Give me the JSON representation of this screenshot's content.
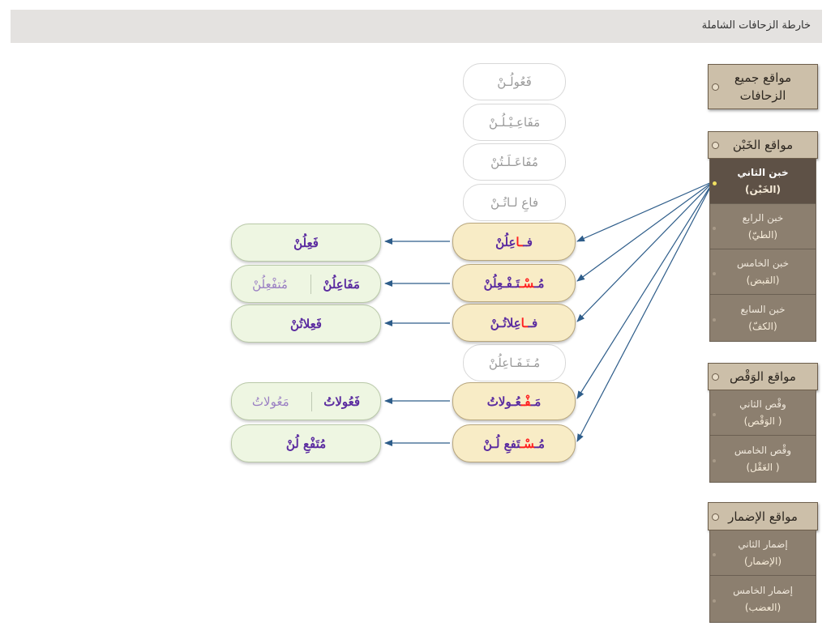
{
  "page_title": "خارطة الزحافات الشاملة",
  "ghost_feet": {
    "f1": "فَعُولُـنْ",
    "f2": "مَفَاعِـيْـلُـنْ",
    "f3": "مُفَاعَـلَـتُنْ",
    "f4": "فاعِ لـاتُـنْ",
    "f5": "مُـتَـفَـاعِلُنْ"
  },
  "active_feet": {
    "a1": {
      "p1": "فـ",
      "red": "ـا",
      "p2": "عِلُنْ"
    },
    "a2": {
      "p1": "مُـ",
      "red": "سْـ",
      "p2": "تَـفْـعِلُنْ"
    },
    "a3": {
      "p1": "فـ",
      "red": "ـا",
      "p2": "عِلاتُـنْ"
    },
    "a4": {
      "p1": "مَـ",
      "red": "فْـ",
      "p2": "عُـولاتُ"
    },
    "a5": {
      "p1": "مُـ",
      "red": "سْـ",
      "p2": "تَفعِ لُـنْ"
    }
  },
  "results": {
    "r1": "فَعِلُنْ",
    "r2_main": "مَفَاعِلُنْ",
    "r2_alt": "مُتفْعِلُنْ",
    "r3": "فَعِلاتُنْ",
    "r4_main": "فَعُولاتُ",
    "r4_alt": "مَعُولاتُ",
    "r5": "مُتَفْعِ لُنْ"
  },
  "panel": {
    "all": "مواقع جميع الزحافات",
    "khabn": {
      "header": "مواقع الخَبْن",
      "items": [
        {
          "label": "خبن الثاني",
          "sub": "(الخَبْن)"
        },
        {
          "label": "خبن الرابع",
          "sub": "(الطيّ)"
        },
        {
          "label": "خبن الخامس",
          "sub": "(القبض)"
        },
        {
          "label": "خبن السابع",
          "sub": "(الكفّ)"
        }
      ]
    },
    "waqs": {
      "header": "مواقع الوَقْص",
      "items": [
        {
          "label": "وقْص الثاني",
          "sub": "( الوَقْص)"
        },
        {
          "label": "وقْص الخامس",
          "sub": "( العَقْل)"
        }
      ]
    },
    "idmar": {
      "header": "مواقع الإضمار",
      "items": [
        {
          "label": "إضمار الثاني",
          "sub": "(الإضمار)"
        },
        {
          "label": "إضمار الخامس",
          "sub": "(العضب)"
        }
      ]
    }
  },
  "colors": {
    "accent_purple": "#5b2ca0",
    "highlight_red": "#ff2020",
    "arrow_blue": "#2e5d8a"
  }
}
